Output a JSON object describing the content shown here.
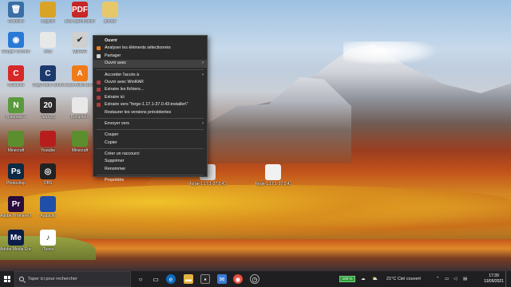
{
  "desktop_icons": [
    {
      "label": "Corbeille",
      "glyph": "🗑",
      "color": "#3a6ea5"
    },
    {
      "label": "Logiciel",
      "glyph": "",
      "color": "#d9a326"
    },
    {
      "label": "Jeux openfrontier",
      "glyph": "PDF",
      "color": "#c62828"
    },
    {
      "label": "private",
      "glyph": "",
      "color": "#e6c86a"
    },
    {
      "label": "Google Chrome",
      "glyph": "◉",
      "color": "#2a7ad5"
    },
    {
      "label": "Jeux",
      "glyph": "",
      "color": "#e8e8e8"
    },
    {
      "label": "MyRAG",
      "glyph": "✔",
      "color": "#cfcfcf"
    },
    {
      "label": "CCleaner",
      "glyph": "C",
      "color": "#d62828"
    },
    {
      "label": "CopyTrans Control Center",
      "glyph": "C",
      "color": "#1d3a6e"
    },
    {
      "label": "Avast Antivirus Gratuit",
      "glyph": "A",
      "color": "#f07a18"
    },
    {
      "label": "Notepad++",
      "glyph": "N",
      "color": "#5a9a3c"
    },
    {
      "label": "Jeux 20",
      "glyph": "20",
      "color": "#2a2a2a"
    },
    {
      "label": "Document",
      "glyph": "",
      "color": "#e8e8e8"
    },
    {
      "label": "Minecraft",
      "glyph": "",
      "color": "#5b8f2e"
    },
    {
      "label": "Youtube",
      "glyph": "",
      "color": "#b81d1d"
    },
    {
      "label": "Minecraft",
      "glyph": "",
      "color": "#5b8f2e"
    },
    {
      "label": "Photoshop",
      "glyph": "Ps",
      "color": "#0b2a44"
    },
    {
      "label": "OBS",
      "glyph": "◎",
      "color": "#222"
    },
    {
      "label": "Adobe Premiere Pro 2020",
      "glyph": "Pr",
      "color": "#2a0b3d"
    },
    {
      "label": "Audacity",
      "glyph": "",
      "color": "#1f4fa8"
    },
    {
      "label": "Adobe Media Encoder",
      "glyph": "Me",
      "color": "#0b1c4a"
    },
    {
      "label": "iTunes",
      "glyph": "♪",
      "color": "#ffffff"
    },
    {
      "label": "forge-1.17.1-37.0.43-installer",
      "glyph": "",
      "color": "#d9d9d9"
    },
    {
      "label": "forge-1.17.1-37.0.43-installer",
      "glyph": "",
      "color": "#f1f1f1"
    }
  ],
  "context_menu": {
    "items": [
      {
        "label": "Ouvrir",
        "bold": true
      },
      {
        "label": "Analyser les éléments sélectionnés",
        "icon_color": "#f07a18"
      },
      {
        "label": "Partager",
        "icon_color": "#cfcfcf"
      },
      {
        "label": "Ouvrir avec",
        "submenu": true,
        "highlight": true
      },
      {
        "label": "Accorder l'accès à",
        "submenu": true
      },
      {
        "label": "Ouvrir avec WinRAR",
        "icon_color": "#b23b3b"
      },
      {
        "label": "Extraire les fichiers...",
        "icon_color": "#b23b3b"
      },
      {
        "label": "Extraire ici",
        "icon_color": "#b23b3b"
      },
      {
        "label": "Extraire vers \"forge-1.17.1-37.0.43-installer\\\"",
        "icon_color": "#b23b3b"
      },
      {
        "label": "Restaurer les versions précédentes"
      },
      {
        "label": "Envoyer vers",
        "submenu": true
      },
      {
        "label": "Couper"
      },
      {
        "label": "Copier"
      },
      {
        "label": "Créer un raccourci"
      },
      {
        "label": "Supprimer"
      },
      {
        "label": "Renommer"
      },
      {
        "label": "Propriétés"
      }
    ]
  },
  "taskbar": {
    "search_placeholder": "Taper ici pour rechercher",
    "battery": "100 %",
    "weather": "21°C Ciel couvert",
    "time": "17:39",
    "date": "13/09/2021"
  }
}
